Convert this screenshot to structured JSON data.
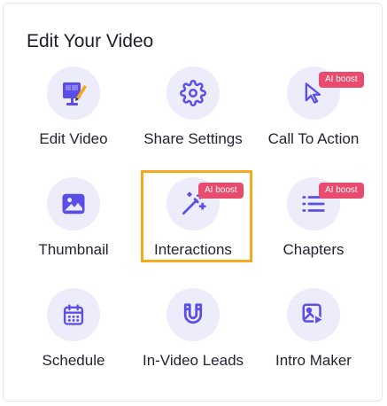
{
  "panel": {
    "title": "Edit Your Video",
    "tiles": [
      {
        "label": "Edit Video",
        "icon": "edit-video-icon",
        "badge": ""
      },
      {
        "label": "Share Settings",
        "icon": "gear-icon",
        "badge": ""
      },
      {
        "label": "Call To Action",
        "icon": "cursor-arrow-icon",
        "badge": "AI boost"
      },
      {
        "label": "Thumbnail",
        "icon": "image-icon",
        "badge": ""
      },
      {
        "label": "Interactions",
        "icon": "magic-wand-icon",
        "badge": "AI boost",
        "highlighted": true
      },
      {
        "label": "Chapters",
        "icon": "list-icon",
        "badge": "AI boost"
      },
      {
        "label": "Schedule",
        "icon": "calendar-icon",
        "badge": ""
      },
      {
        "label": "In-Video Leads",
        "icon": "magnet-icon",
        "badge": ""
      },
      {
        "label": "Intro Maker",
        "icon": "video-image-icon",
        "badge": ""
      }
    ]
  },
  "colors": {
    "accent": "#5b4ee8",
    "icon_bg": "#ececfb",
    "badge": "#e84b6d",
    "highlight": "#f7a81b"
  }
}
